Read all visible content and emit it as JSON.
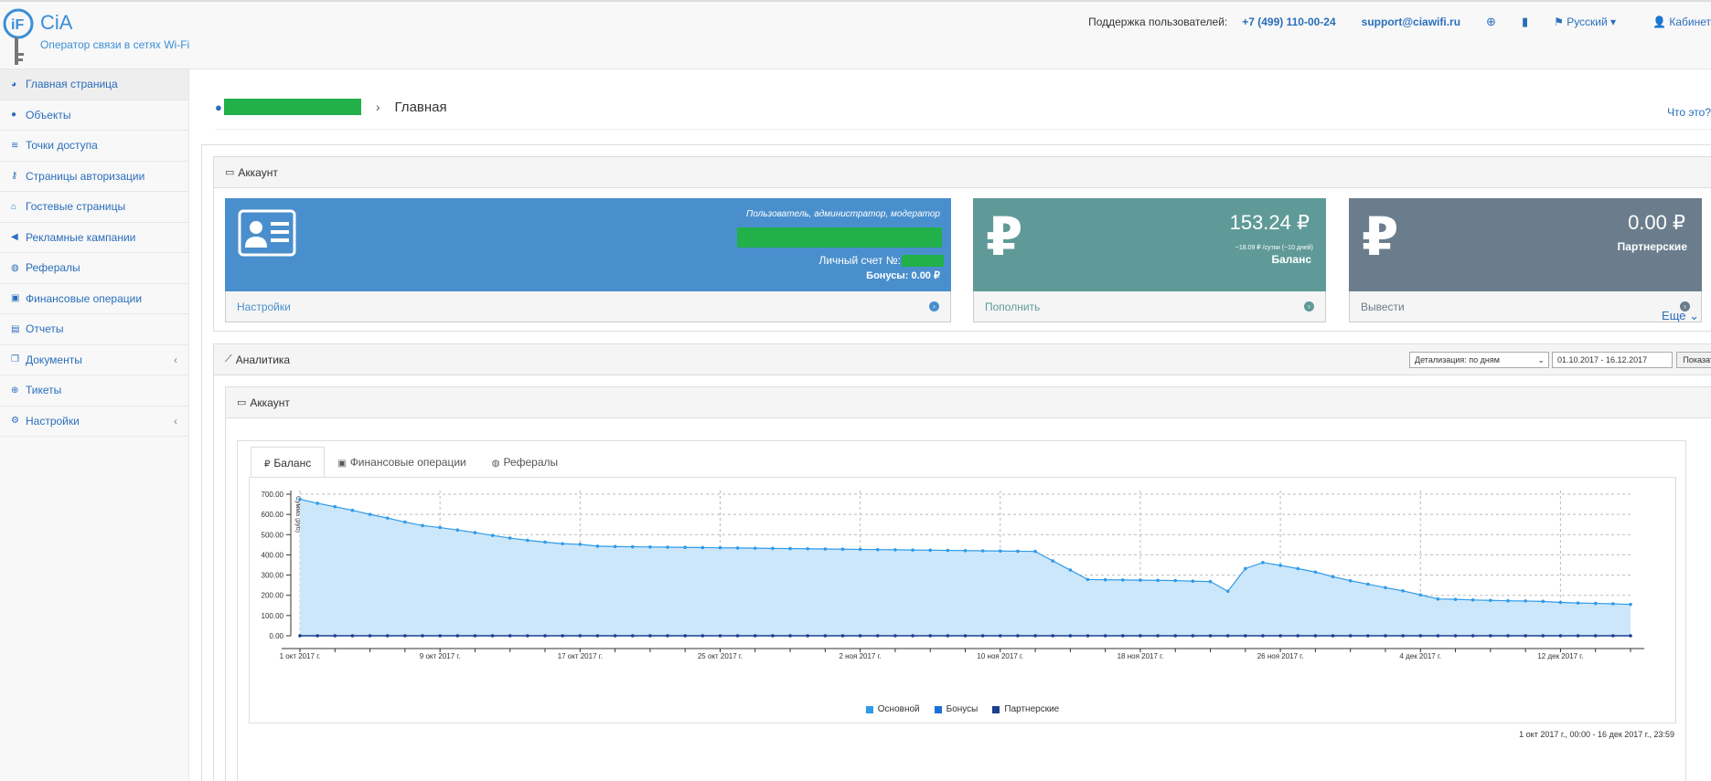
{
  "header": {
    "logo_title": "CiA",
    "logo_sub": "Оператор связи в сетях Wi-Fi",
    "support_label": "Поддержка пользователей:",
    "phone": "+7 (499) 110-00-24",
    "email": "support@ciawifi.ru",
    "help_icon": "lifebuoy-icon",
    "book_icon": "book-icon",
    "language": "Русский",
    "cabinet": "Кабинет"
  },
  "sidebar": {
    "items": [
      {
        "label": "Главная страница",
        "icon": "dashboard-icon"
      },
      {
        "label": "Объекты",
        "icon": "map-marker-icon"
      },
      {
        "label": "Точки доступа",
        "icon": "wifi-icon"
      },
      {
        "label": "Страницы авторизации",
        "icon": "key-icon"
      },
      {
        "label": "Гостевые страницы",
        "icon": "home-icon"
      },
      {
        "label": "Рекламные кампании",
        "icon": "bullhorn-icon"
      },
      {
        "label": "Рефералы",
        "icon": "users-icon"
      },
      {
        "label": "Финансовые операции",
        "icon": "money-icon"
      },
      {
        "label": "Отчеты",
        "icon": "file-icon"
      },
      {
        "label": "Документы",
        "icon": "copy-icon"
      },
      {
        "label": "Тикеты",
        "icon": "lifebuoy-icon"
      },
      {
        "label": "Настройки",
        "icon": "cogs-icon"
      }
    ]
  },
  "breadcrumb": {
    "page_title": "Главная",
    "what_is_this": "Что это?"
  },
  "account_panel": {
    "title": "Аккаунт",
    "user_card": {
      "roles": "Пользователь, администратор, модератор",
      "account_label": "Личный счет №:",
      "bonuses": "Бонусы: 0.00",
      "footer": "Настройки",
      "color": "#4a8fcd"
    },
    "balance_card": {
      "amount": "153.24 ₽",
      "per_day": "~18.09 ₽ /сутки (~10 дней)",
      "label": "Баланс",
      "footer": "Пополнить",
      "color": "#5f9a98"
    },
    "partner_card": {
      "amount": "0.00 ₽",
      "label": "Партнерские",
      "footer": "Вывести",
      "color": "#6b7d8c"
    },
    "more": "Еще"
  },
  "analytics_panel": {
    "title": "Аналитика",
    "detail_select": "Детализация: по дням",
    "date_range": "01.10.2017 - 16.12.2017",
    "show_button": "Показать",
    "sub_title": "Аккаунт",
    "tabs": [
      "Баланс",
      "Финансовые операции",
      "Рефералы"
    ],
    "range_note": "1 окт 2017 г., 00:00 - 16 дек 2017 г., 23:59"
  },
  "chart_data": {
    "type": "area",
    "ylabel": "Сумма (руб)",
    "ylim": [
      0,
      700
    ],
    "yticks": [
      "0.00",
      "100.00",
      "200.00",
      "300.00",
      "400.00",
      "500.00",
      "600.00",
      "700.00"
    ],
    "xtick_labels": [
      "1 окт 2017 г.",
      "9 окт 2017 г.",
      "17 окт 2017 г.",
      "25 окт 2017 г.",
      "2 ноя 2017 г.",
      "10 ноя 2017 г.",
      "18 ноя 2017 г.",
      "26 ноя 2017 г.",
      "4 дек 2017 г.",
      "12 дек 2017 г."
    ],
    "xtick_days": [
      0,
      8,
      16,
      24,
      32,
      40,
      48,
      56,
      64,
      72
    ],
    "grid": true,
    "legend_position": "bottom",
    "series": [
      {
        "name": "Основной",
        "color": "#2f9be9",
        "values": [
          675,
          655,
          638,
          620,
          600,
          582,
          562,
          545,
          535,
          523,
          510,
          496,
          483,
          472,
          463,
          455,
          452,
          443,
          441,
          440,
          439,
          438,
          437,
          436,
          435,
          434,
          433,
          432,
          431,
          430,
          429,
          428,
          427,
          426,
          425,
          424,
          423,
          422,
          421,
          420,
          419,
          418,
          417,
          370,
          325,
          278,
          277,
          276,
          275,
          274,
          273,
          270,
          268,
          220,
          332,
          362,
          348,
          332,
          315,
          292,
          272,
          255,
          238,
          222,
          202,
          182,
          180,
          177,
          175,
          173,
          172,
          170,
          165,
          162,
          160,
          158,
          155
        ]
      },
      {
        "name": "Бонусы",
        "color": "#1b6fd6",
        "values": [
          0
        ]
      },
      {
        "name": "Партнерские",
        "color": "#1a3f8f",
        "values": [
          0
        ]
      }
    ]
  }
}
